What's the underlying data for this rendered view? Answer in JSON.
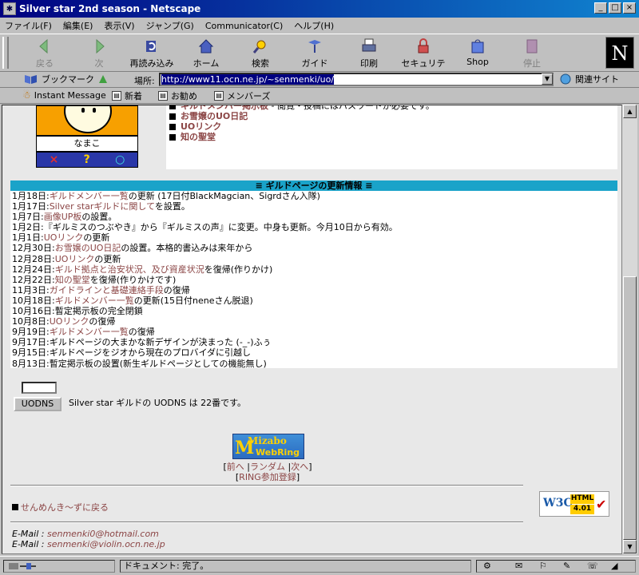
{
  "window": {
    "title": "Silver star 2nd season - Netscape",
    "controls": {
      "minimize": "_",
      "maximize": "□",
      "close": "×"
    }
  },
  "menu": [
    "ファイル(F)",
    "編集(E)",
    "表示(V)",
    "ジャンプ(G)",
    "Communicator(C)",
    "ヘルプ(H)"
  ],
  "toolbar": {
    "buttons": [
      {
        "label": "戻る",
        "icon": "back-arrow-icon",
        "disabled": true
      },
      {
        "label": "次",
        "icon": "forward-arrow-icon",
        "disabled": true
      },
      {
        "label": "再読み込み",
        "icon": "reload-icon",
        "disabled": false
      },
      {
        "label": "ホーム",
        "icon": "home-icon",
        "disabled": false
      },
      {
        "label": "検索",
        "icon": "search-icon",
        "disabled": false
      },
      {
        "label": "ガイド",
        "icon": "guide-icon",
        "disabled": false
      },
      {
        "label": "印刷",
        "icon": "print-icon",
        "disabled": false
      },
      {
        "label": "セキュリティ",
        "icon": "security-lock-icon",
        "disabled": false
      },
      {
        "label": "Shop",
        "icon": "shop-icon",
        "disabled": false
      },
      {
        "label": "停止",
        "icon": "stop-icon",
        "disabled": true
      }
    ],
    "logo": "N"
  },
  "location": {
    "bookmarks_label": "ブックマーク",
    "location_label": "場所:",
    "url": "http://www11.ocn.ne.jp/~senmenki/uo/",
    "related_label": "関連サイト"
  },
  "personal_bar": [
    "Instant Message",
    "新着",
    "お勧め",
    "メンバーズ"
  ],
  "page": {
    "avatar_name": "なまこ",
    "avatar_buttons": [
      "×",
      "?",
      "○"
    ],
    "menu_items": [
      {
        "text": "ギルドメンバー掲示板",
        "suffix": " - 閲覧・投稿にはパスワードが必要です。"
      },
      {
        "text": "お雪嬢のUO日記",
        "suffix": ""
      },
      {
        "text": "UOリンク",
        "suffix": ""
      },
      {
        "text": "知の聖堂",
        "suffix": ""
      }
    ],
    "news_header": "≡ ギルドページの更新情報 ≡",
    "news": [
      {
        "date": "1月18日:",
        "link": "ギルドメンバー一覧",
        "text": "の更新 (17日付BlackMagcian、Sigrdさん入隊)"
      },
      {
        "date": "1月17日:",
        "link": "Silver starギルドに関して",
        "text": "を設置。"
      },
      {
        "date": "1月7日:",
        "link": "画像UP板",
        "text": "の設置。"
      },
      {
        "date": "1月2日:",
        "link": "",
        "text": "『ギルミスのつぶやき』から『ギルミスの声』に変更。中身も更新。今月10日から有効。"
      },
      {
        "date": "1月1日:",
        "link": "UOリンク",
        "text": "の更新"
      },
      {
        "date": "12月30日:",
        "link": "お雪嬢のUO日記",
        "text": "の設置。本格的書込みは来年から"
      },
      {
        "date": "12月28日:",
        "link": "UOリンク",
        "text": "の更新"
      },
      {
        "date": "12月24日:",
        "link": "ギルド拠点と治安状況、及び資産状況",
        "text": "を復帰(作りかけ)"
      },
      {
        "date": "12月22日:",
        "link": "知の聖堂",
        "text": "を復帰(作りかけです)"
      },
      {
        "date": "11月3日:",
        "link": "ガイドラインと基礎連絡手段",
        "text": "の復帰"
      },
      {
        "date": "10月18日:",
        "link": "ギルドメンバー一覧",
        "text": "の更新(15日付neneさん脱退)"
      },
      {
        "date": "10月16日:",
        "link": "",
        "text": "暫定掲示板の完全閉鎖"
      },
      {
        "date": "10月8日:",
        "link": "UOリンク",
        "text": "の復帰"
      },
      {
        "date": "9月19日:",
        "link": "ギルドメンバー一覧",
        "text": "の復帰"
      },
      {
        "date": "9月17日:",
        "link": "",
        "text": "ギルドページの大まかな新デザインが決まった (-_-)ふぅ"
      },
      {
        "date": "9月15日:",
        "link": "",
        "text": "ギルドページをジオから現在のプロバイダに引越し"
      },
      {
        "date": "8月13日:",
        "link": "",
        "text": "暫定掲示板の設置(新生ギルドページとしての機能無し)"
      }
    ],
    "uodns": {
      "input_value": "",
      "button": "UODNS",
      "text": "Silver star ギルドの UODNS は 22番です。"
    },
    "webring": {
      "logo_top": "Mizabo",
      "logo_bottom": "WebRing",
      "prev": "前へ",
      "random": "ランダム",
      "next": "次へ",
      "join": "RING参加登録"
    },
    "back_link": "せんめんき～ずに戻る",
    "w3c": {
      "w3c": "W3C",
      "html": "HTML",
      "version": "4.01"
    },
    "emails": [
      {
        "label": "E-Mail :",
        "addr": "senmenki0@hotmail.com"
      },
      {
        "label": "E-Mail :",
        "addr": "senmenki@violin.ocn.ne.jp"
      }
    ]
  },
  "status": {
    "text": "ドキュメント: 完了。"
  }
}
